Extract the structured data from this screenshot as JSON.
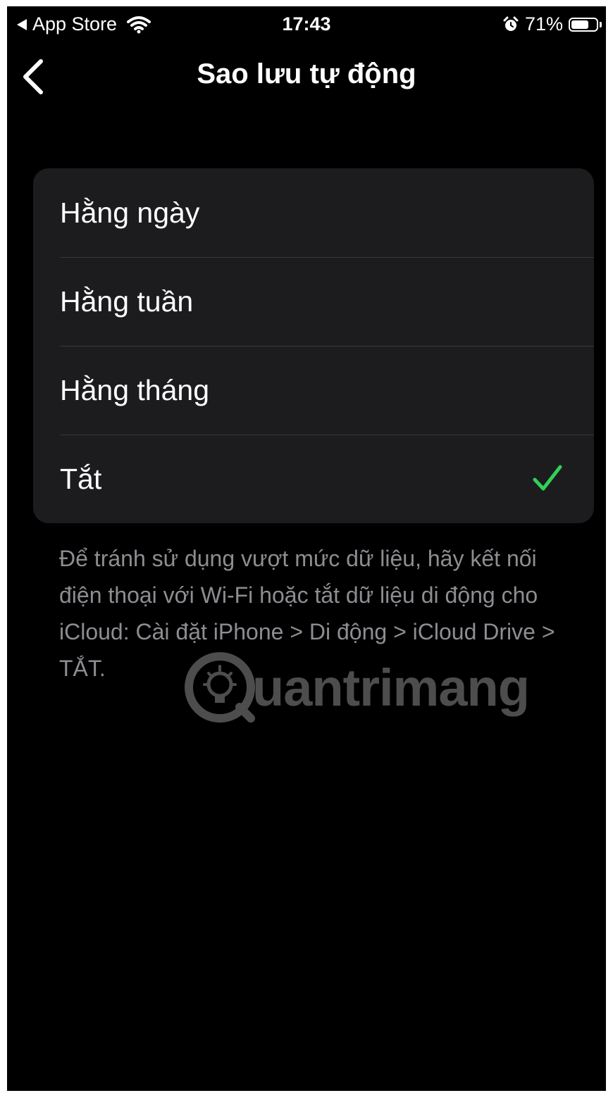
{
  "status_bar": {
    "back_app": "App Store",
    "time": "17:43",
    "battery_percent": "71%",
    "battery_level": 0.71,
    "icons": [
      "back-triangle-icon",
      "wifi-icon",
      "alarm-icon",
      "battery-icon"
    ]
  },
  "nav": {
    "title": "Sao lưu tự động",
    "back_icon": "chevron-left-icon"
  },
  "options": [
    {
      "label": "Hằng ngày",
      "selected": false
    },
    {
      "label": "Hằng tuần",
      "selected": false
    },
    {
      "label": "Hằng tháng",
      "selected": false
    },
    {
      "label": "Tắt",
      "selected": true
    }
  ],
  "colors": {
    "background": "#000000",
    "group_background": "#1c1c1e",
    "check": "#30d158",
    "secondary_text": "#8d8d92"
  },
  "footnote": "Để tránh sử dụng vượt mức dữ liệu, hãy kết nối điện thoại với Wi-Fi hoặc tắt dữ liệu di động cho iCloud: Cài đặt iPhone > Di động > iCloud Drive > TẮT.",
  "watermark": {
    "text": "uantrimang"
  }
}
